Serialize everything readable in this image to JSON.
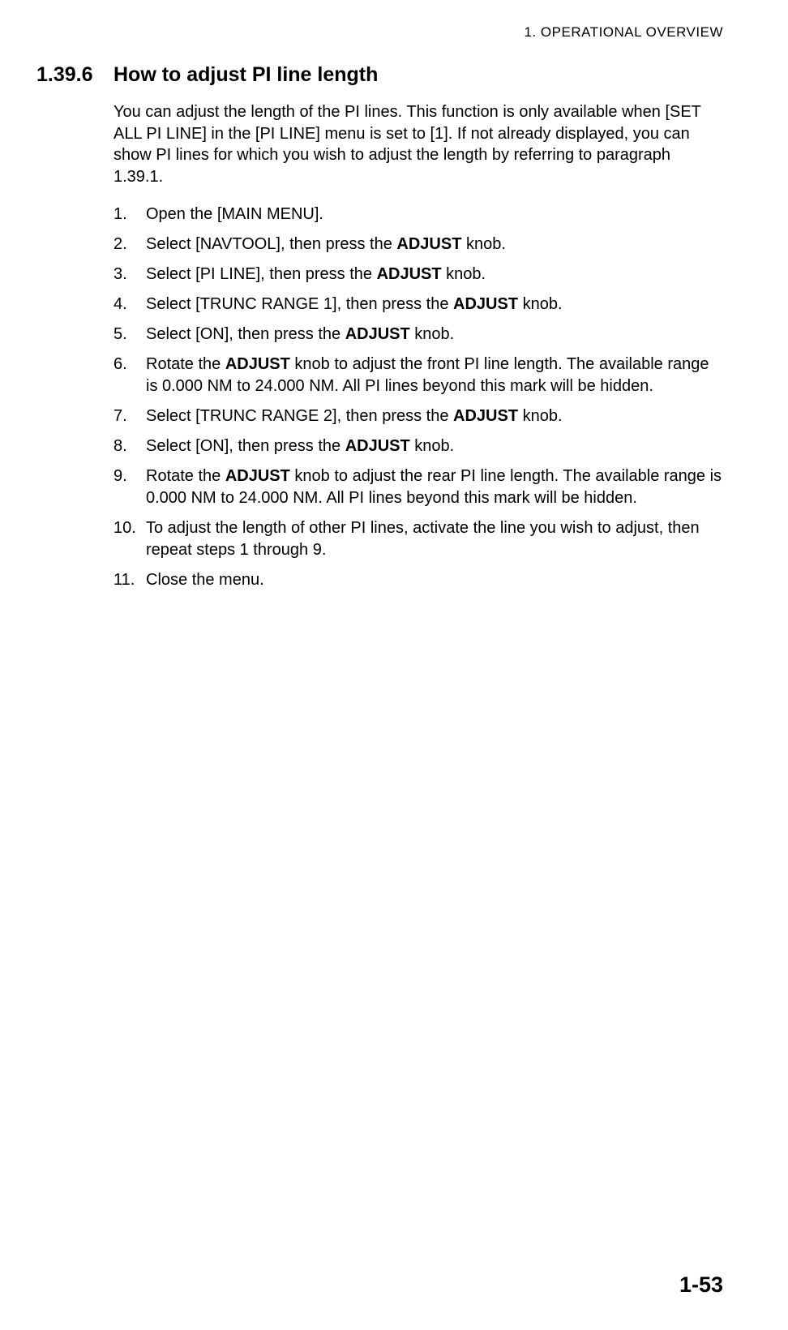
{
  "header": {
    "chapter_label": "1.  OPERATIONAL OVERVIEW"
  },
  "section": {
    "number": "1.39.6",
    "title": "How to adjust PI line length"
  },
  "intro": "You can adjust the length of the PI lines. This function is only available when [SET ALL PI LINE] in the [PI LINE] menu is set to [1]. If not already displayed, you can show PI lines for which you wish to adjust the length by referring to paragraph 1.39.1.",
  "steps": [
    {
      "n": "1.",
      "text_before": "Open the [MAIN MENU].",
      "bold": "",
      "text_after": ""
    },
    {
      "n": "2.",
      "text_before": "Select [NAVTOOL], then press the ",
      "bold": "ADJUST",
      "text_after": " knob."
    },
    {
      "n": "3.",
      "text_before": "Select [PI LINE], then press the ",
      "bold": "ADJUST",
      "text_after": " knob."
    },
    {
      "n": "4.",
      "text_before": "Select [TRUNC RANGE 1], then press the ",
      "bold": "ADJUST",
      "text_after": " knob."
    },
    {
      "n": "5.",
      "text_before": "Select [ON], then press the ",
      "bold": "ADJUST",
      "text_after": " knob."
    },
    {
      "n": "6.",
      "text_before": "Rotate the ",
      "bold": "ADJUST",
      "text_after": " knob to adjust the front PI line length. The available range is 0.000 NM to 24.000 NM. All PI lines beyond this mark will be hidden."
    },
    {
      "n": "7.",
      "text_before": "Select [TRUNC RANGE 2], then press the ",
      "bold": "ADJUST",
      "text_after": " knob."
    },
    {
      "n": "8.",
      "text_before": "Select [ON], then press the ",
      "bold": "ADJUST",
      "text_after": " knob."
    },
    {
      "n": "9.",
      "text_before": "Rotate the ",
      "bold": "ADJUST",
      "text_after": " knob to adjust the rear PI line length. The available range is 0.000 NM to 24.000 NM. All PI lines beyond this mark will be hidden."
    },
    {
      "n": "10.",
      "text_before": "To adjust the length of other PI lines, activate the line you wish to adjust, then repeat steps 1 through 9.",
      "bold": "",
      "text_after": ""
    },
    {
      "n": "11.",
      "text_before": "Close the menu.",
      "bold": "",
      "text_after": ""
    }
  ],
  "page_number": "1-53"
}
